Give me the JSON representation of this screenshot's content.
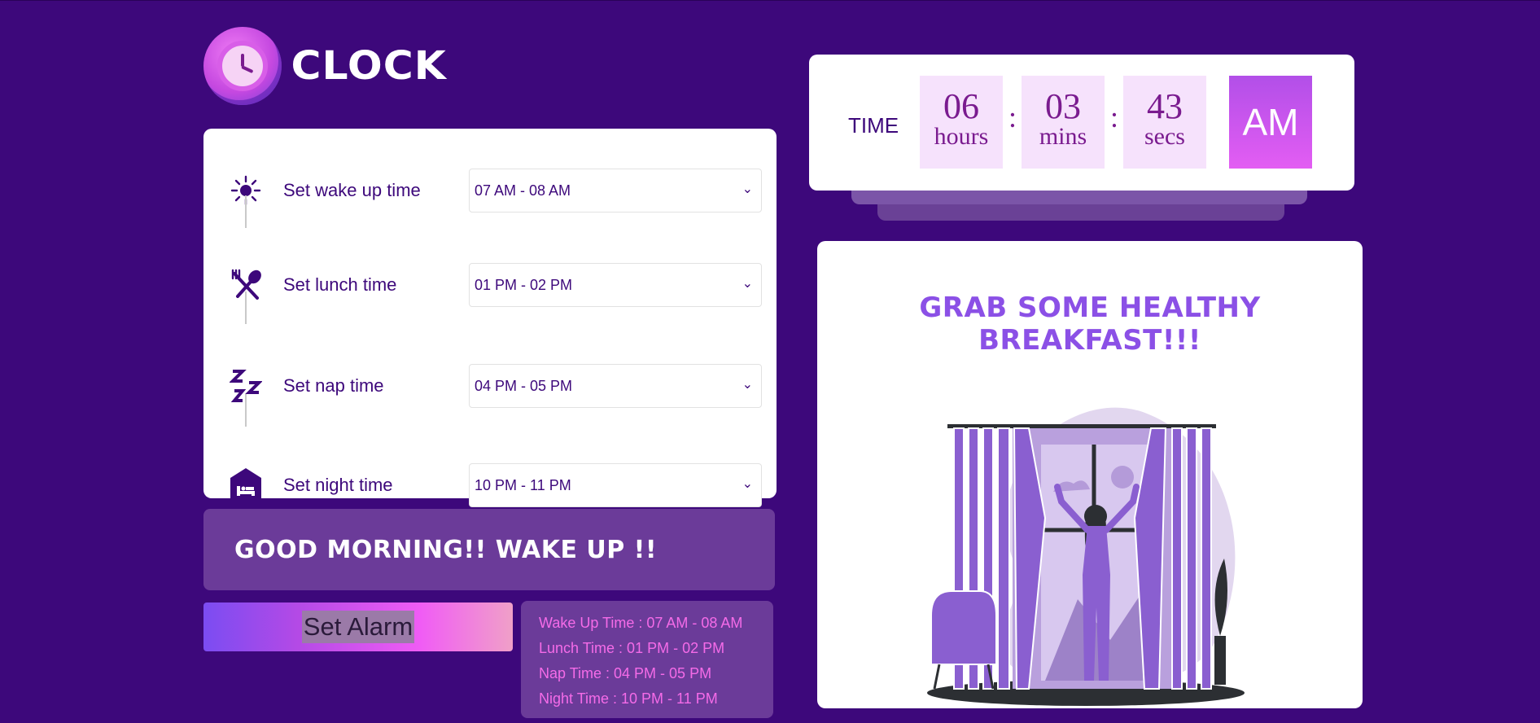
{
  "app": {
    "title": "CLOCK"
  },
  "schedule": [
    {
      "label": "Set wake up time",
      "value": "07 AM - 08 AM",
      "icon": "sun-icon"
    },
    {
      "label": "Set lunch time",
      "value": "01 PM - 02 PM",
      "icon": "fork-spoon-icon"
    },
    {
      "label": "Set nap time",
      "value": "04 PM - 05 PM",
      "icon": "zzz-icon"
    },
    {
      "label": "Set night time",
      "value": "10 PM - 11 PM",
      "icon": "bed-icon"
    }
  ],
  "greeting": "GOOD MORNING!! WAKE UP !!",
  "alarm_button": "Set Alarm",
  "summary": [
    "Wake Up Time : 07 AM - 08 AM",
    "Lunch Time : 01 PM - 02 PM",
    "Nap Time : 04 PM - 05 PM",
    "Night Time : 10 PM - 11 PM"
  ],
  "clock": {
    "label": "TIME",
    "hours": "06",
    "hours_unit": "hours",
    "mins": "03",
    "mins_unit": "mins",
    "secs": "43",
    "secs_unit": "secs",
    "separator": ":",
    "period": "AM"
  },
  "message": "GRAB SOME HEALTHY BREAKFAST!!!",
  "colors": {
    "background": "#3d087b",
    "accent": "#8b50e6",
    "pink": "#f56be8"
  }
}
